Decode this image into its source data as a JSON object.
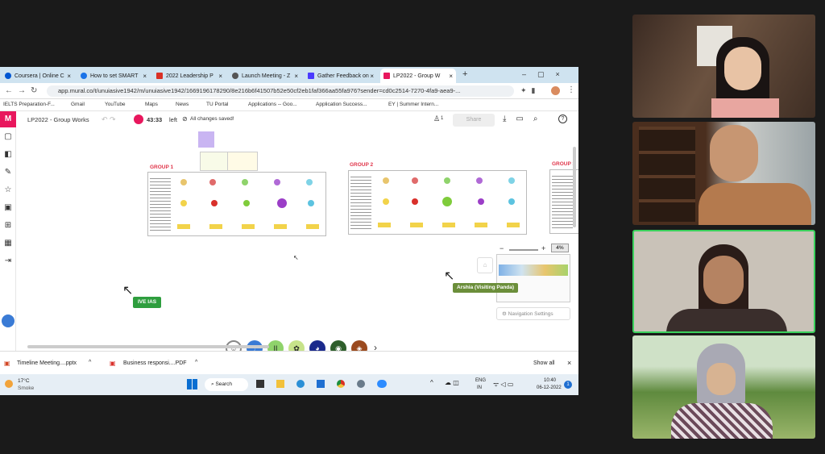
{
  "browser": {
    "tabs": [
      {
        "label": "Coursera | Online C",
        "color": "#0056d2"
      },
      {
        "label": "How to set SMART",
        "color": "#1a73e8"
      },
      {
        "label": "2022 Leadership P",
        "color": "#d93025"
      },
      {
        "label": "Launch Meeting - Z",
        "color": "#555555"
      },
      {
        "label": "Gather Feedback on",
        "color": "#4a3aff"
      },
      {
        "label": "LP2022 - Group W",
        "color": "#e8175d"
      }
    ],
    "new_tab": "+",
    "url": "app.mural.co/t/unuiasive1942/m/unuiasive1942/1669196178290/8e216b6f41507b52e50cf2eb1faf366aa55fa976?sender=cd0c2514-7270-4fa9-aea9-...",
    "bookmarks": [
      "IELTS Preparation-F...",
      "Gmail",
      "YouTube",
      "Maps",
      "News",
      "TU Portal",
      "Applications -- Goo...",
      "Application Success...",
      "EY | Summer Intern..."
    ]
  },
  "mural": {
    "board_title": "LP2022 - Group Works",
    "timer": "43:33",
    "timer_suffix": "left",
    "save_status": "All changes saved!",
    "participants": "1",
    "share_label": "Share",
    "groups": [
      "GROUP 1",
      "GROUP 2",
      "GROUP 3"
    ],
    "zoom": "4%",
    "zoom_minus": "−",
    "zoom_plus": "+",
    "nav_settings": "Navigation Settings",
    "cursor_label_1": "IVE IAS",
    "cursor_label_2": "Arshia (Visiting Panda)"
  },
  "downloads": {
    "items": [
      "Timeline Meeting....pptx",
      "Business responsi....PDF"
    ],
    "show_all": "Show all"
  },
  "taskbar": {
    "temp": "17°C",
    "weather": "Smoke",
    "search": "Search",
    "lang_top": "ENG",
    "lang_bottom": "IN",
    "time": "10:40",
    "date": "06-12-2022",
    "badge": "1"
  },
  "colors": {
    "mural_accent": "#e8175d",
    "group_label": "#e0354a",
    "active_speaker": "#3bd15c"
  }
}
